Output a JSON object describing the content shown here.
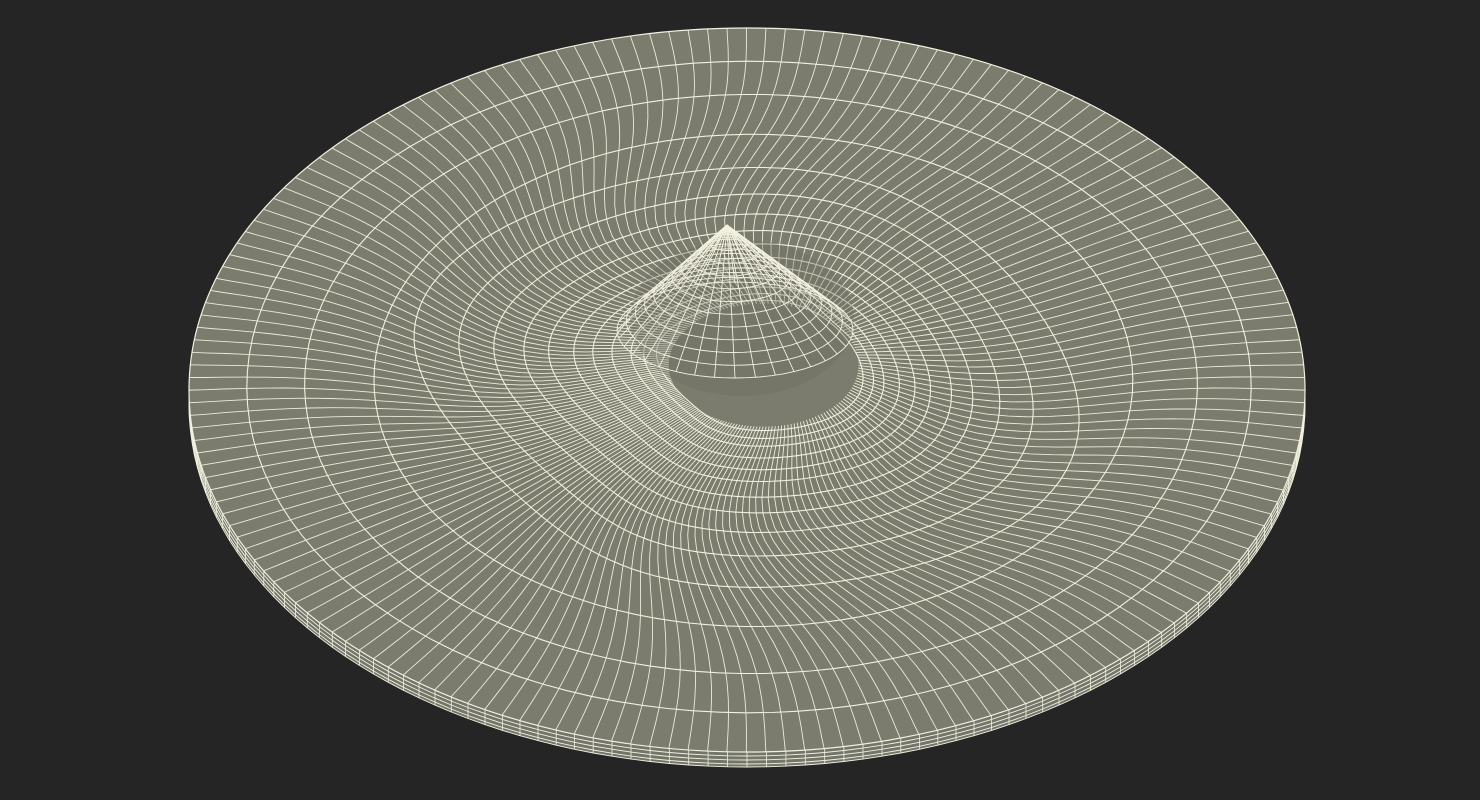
{
  "scene": {
    "background_color": "#252525",
    "surface_color": "#7b7c6d",
    "rim_color": "#73746a",
    "shadow_color": "#6a6b5f",
    "wire_color": "#f2f1df",
    "object": "wireframe-disc-with-central-peak"
  }
}
